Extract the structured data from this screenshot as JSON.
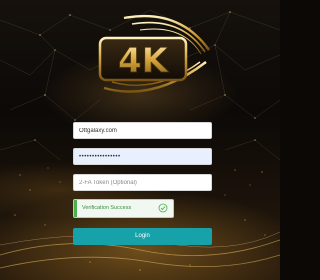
{
  "brand": {
    "logo_text": "4K"
  },
  "form": {
    "username_value": "Ottgalaxy.com",
    "password_value": "••••••••••••••••",
    "token_placeholder": "2-FA Token (Optional)",
    "token_value": ""
  },
  "captcha": {
    "status_text": "Verification Success",
    "check_icon": "check-circle-icon",
    "accent_color": "#4caf50"
  },
  "actions": {
    "login_label": "Login",
    "login_color": "#17a2a9"
  }
}
